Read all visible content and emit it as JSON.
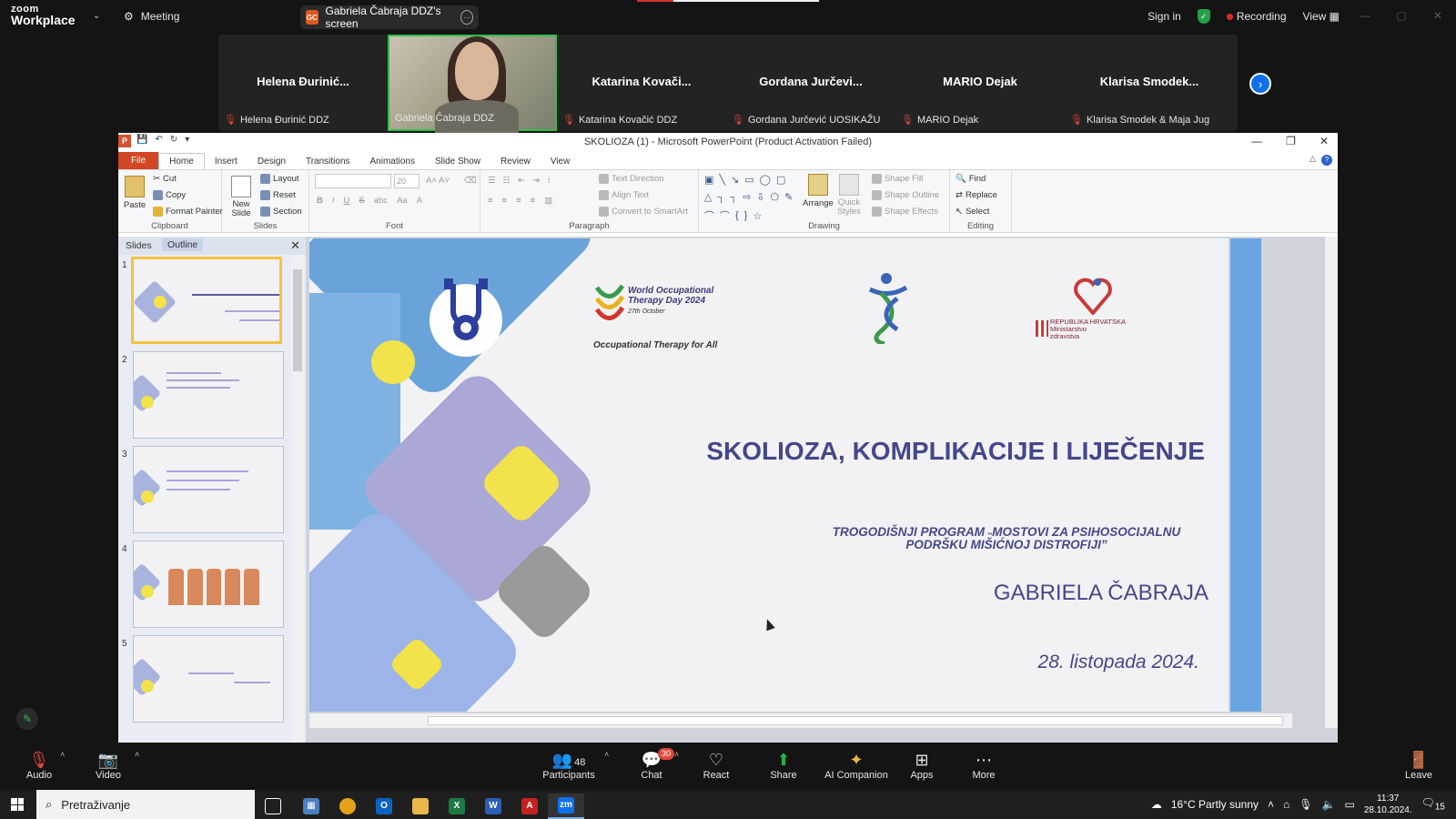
{
  "zoom": {
    "logo": {
      "line1": "zoom",
      "line2": "Workplace"
    },
    "meeting_label": "Meeting",
    "share_pill": {
      "initials": "GC",
      "label": "Gabriela Čabraja DDZ's screen"
    },
    "top_right": {
      "sign_in": "Sign in",
      "recording": "Recording",
      "view": "View"
    },
    "participants": [
      {
        "big": "Helena Đurinić...",
        "name": "Helena Đurinić DDZ",
        "muted": true
      },
      {
        "big": "",
        "name": "Gabriela Čabraja DDZ",
        "muted": false,
        "video": true
      },
      {
        "big": "Katarina Kovači...",
        "name": "Katarina Kovačić DDZ",
        "muted": true
      },
      {
        "big": "Gordana Jurčevi...",
        "name": "Gordana Jurčević UOSIKAŽU",
        "muted": true
      },
      {
        "big": "MARIO Dejak",
        "name": "MARIO Dejak",
        "muted": true
      },
      {
        "big": "Klarisa Smodek...",
        "name": "Klarisa Smodek & Maja Jug",
        "muted": true
      }
    ],
    "toolbar": {
      "audio": "Audio",
      "video": "Video",
      "participants": "Participants",
      "participant_count": "48",
      "chat": "Chat",
      "chat_badge": "30",
      "react": "React",
      "share": "Share",
      "ai": "AI Companion",
      "apps": "Apps",
      "more": "More",
      "leave": "Leave"
    }
  },
  "ppt": {
    "title": "SKOLIOZA  (1)  -  Microsoft PowerPoint (Product Activation Failed)",
    "tabs": [
      "File",
      "Home",
      "Insert",
      "Design",
      "Transitions",
      "Animations",
      "Slide Show",
      "Review",
      "View"
    ],
    "selected_tab": "Home",
    "ribbon": {
      "clipboard": {
        "paste": "Paste",
        "cut": "Cut",
        "copy": "Copy",
        "format_painter": "Format Painter",
        "label": "Clipboard"
      },
      "slides": {
        "new_slide": "New Slide",
        "layout": "Layout",
        "reset": "Reset",
        "section": "Section",
        "label": "Slides"
      },
      "font": {
        "size": "20",
        "label": "Font"
      },
      "paragraph": {
        "text_direction": "Text Direction",
        "align_text": "Align Text",
        "convert": "Convert to SmartArt",
        "label": "Paragraph"
      },
      "drawing": {
        "arrange": "Arrange",
        "quick_styles": "Quick Styles",
        "shape_fill": "Shape Fill",
        "shape_outline": "Shape Outline",
        "shape_effects": "Shape Effects",
        "label": "Drawing"
      },
      "editing": {
        "find": "Find",
        "replace": "Replace",
        "select": "Select",
        "label": "Editing"
      }
    },
    "pane_tabs": {
      "slides": "Slides",
      "outline": "Outline"
    },
    "thumb_numbers": [
      "1",
      "2",
      "3",
      "4",
      "5"
    ],
    "slide": {
      "wotd": {
        "line1": "World Occupational Therapy Day 2024",
        "line2": "27th October",
        "tagline": "Occupational Therapy for All"
      },
      "ministry": {
        "line1": "REPUBLIKA HRVATSKA",
        "line2": "Ministarstvo",
        "line3": "zdravstva"
      },
      "title": "SKOLIOZA, KOMPLIKACIJE  I LIJEČENJE",
      "subtitle": "TROGODIŠNJI PROGRAM ˵MOSTOVI ZA PSIHOSOCIJALNU PODRŠKU MIŠIĆNOJ DISTROFIJI”",
      "presenter": "GABRIELA ČABRAJA",
      "date": "28. listopada 2024."
    }
  },
  "taskbar": {
    "search": "Pretraživanje",
    "weather": "16°C  Partly sunny",
    "time": "11:37",
    "date": "28.10.2024.",
    "notif": "15"
  },
  "colors": {
    "accent": "#45478a",
    "zoom_blue": "#0e71eb",
    "ppt_file": "#d24726",
    "slide_yellow": "#f2e24b"
  }
}
